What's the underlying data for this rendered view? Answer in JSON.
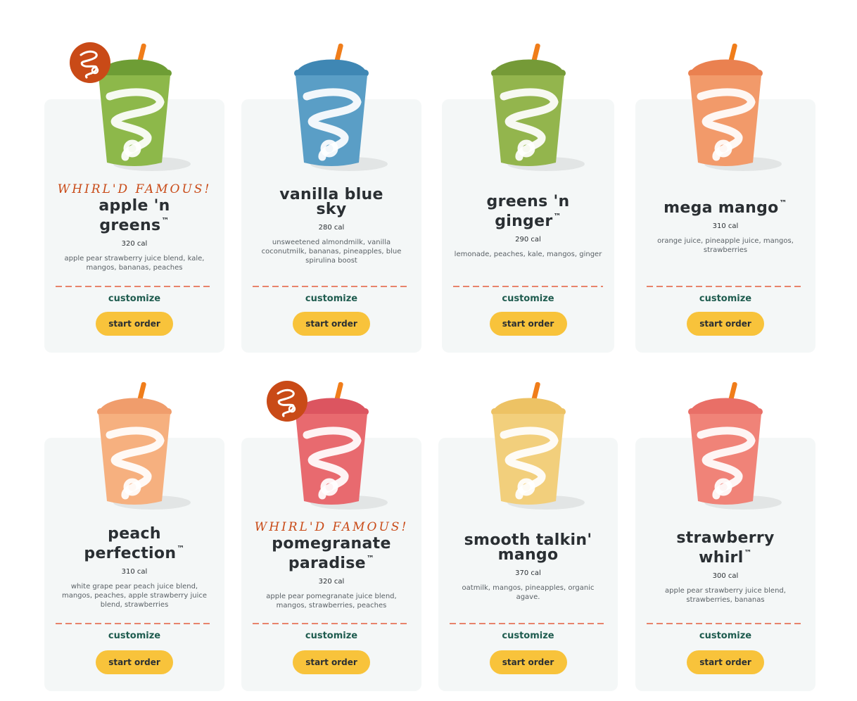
{
  "products": [
    {
      "famous_label": "WHIRL'D FAMOUS!",
      "name_line1": "apple 'n",
      "name_line2": "greens",
      "trademark": "™",
      "calories": "320 cal",
      "ingredients": "apple pear strawberry juice blend, kale, mangos, bananas, peaches",
      "customize_label": "customize",
      "start_label": "start order",
      "cup_color": "#8db84a",
      "foam_color": "#6e9d35",
      "has_badge": true
    },
    {
      "famous_label": "",
      "name_line1": "vanilla blue",
      "name_line2": "sky",
      "trademark": "",
      "calories": "280 cal",
      "ingredients": "unsweetened almondmilk, vanilla coconutmilk, bananas, pineapples, blue spirulina boost",
      "customize_label": "customize",
      "start_label": "start order",
      "cup_color": "#5a9ec6",
      "foam_color": "#3f87b4",
      "has_badge": false
    },
    {
      "famous_label": "",
      "name_line1": "greens 'n",
      "name_line2": "ginger",
      "trademark": "™",
      "calories": "290 cal",
      "ingredients": "lemonade, peaches, kale, mangos, ginger",
      "customize_label": "customize",
      "start_label": "start order",
      "cup_color": "#93b54d",
      "foam_color": "#759a37",
      "has_badge": false
    },
    {
      "famous_label": "",
      "name_line1": "mega mango",
      "name_line2": "",
      "trademark": "™",
      "calories": "310 cal",
      "ingredients": "orange juice, pineapple juice, mangos, strawberries",
      "customize_label": "customize",
      "start_label": "start order",
      "cup_color": "#f29a6a",
      "foam_color": "#ea8150",
      "has_badge": false
    },
    {
      "famous_label": "",
      "name_line1": "peach",
      "name_line2": "perfection",
      "trademark": "™",
      "calories": "310 cal",
      "ingredients": "white grape pear peach juice blend, mangos, peaches, apple strawberry juice blend, strawberries",
      "customize_label": "customize",
      "start_label": "start order",
      "cup_color": "#f6b07f",
      "foam_color": "#f09d6c",
      "has_badge": false
    },
    {
      "famous_label": "WHIRL'D FAMOUS!",
      "name_line1": "pomegranate",
      "name_line2": "paradise",
      "trademark": "™",
      "calories": "320 cal",
      "ingredients": "apple pear pomegranate juice blend, mangos, strawberries, peaches",
      "customize_label": "customize",
      "start_label": "start order",
      "cup_color": "#e86a6f",
      "foam_color": "#dc5560",
      "has_badge": true
    },
    {
      "famous_label": "",
      "name_line1": "smooth talkin'",
      "name_line2": "mango",
      "trademark": "",
      "calories": "370 cal",
      "ingredients": "oatmilk, mangos, pineapples, organic agave.",
      "customize_label": "customize",
      "start_label": "start order",
      "cup_color": "#f2cf7c",
      "foam_color": "#edc264",
      "has_badge": false
    },
    {
      "famous_label": "",
      "name_line1": "strawberry",
      "name_line2": "whirl",
      "trademark": "™",
      "calories": "300 cal",
      "ingredients": "apple pear strawberry juice blend, strawberries, bananas",
      "customize_label": "customize",
      "start_label": "start order",
      "cup_color": "#f08378",
      "foam_color": "#e96f67",
      "has_badge": false
    }
  ]
}
